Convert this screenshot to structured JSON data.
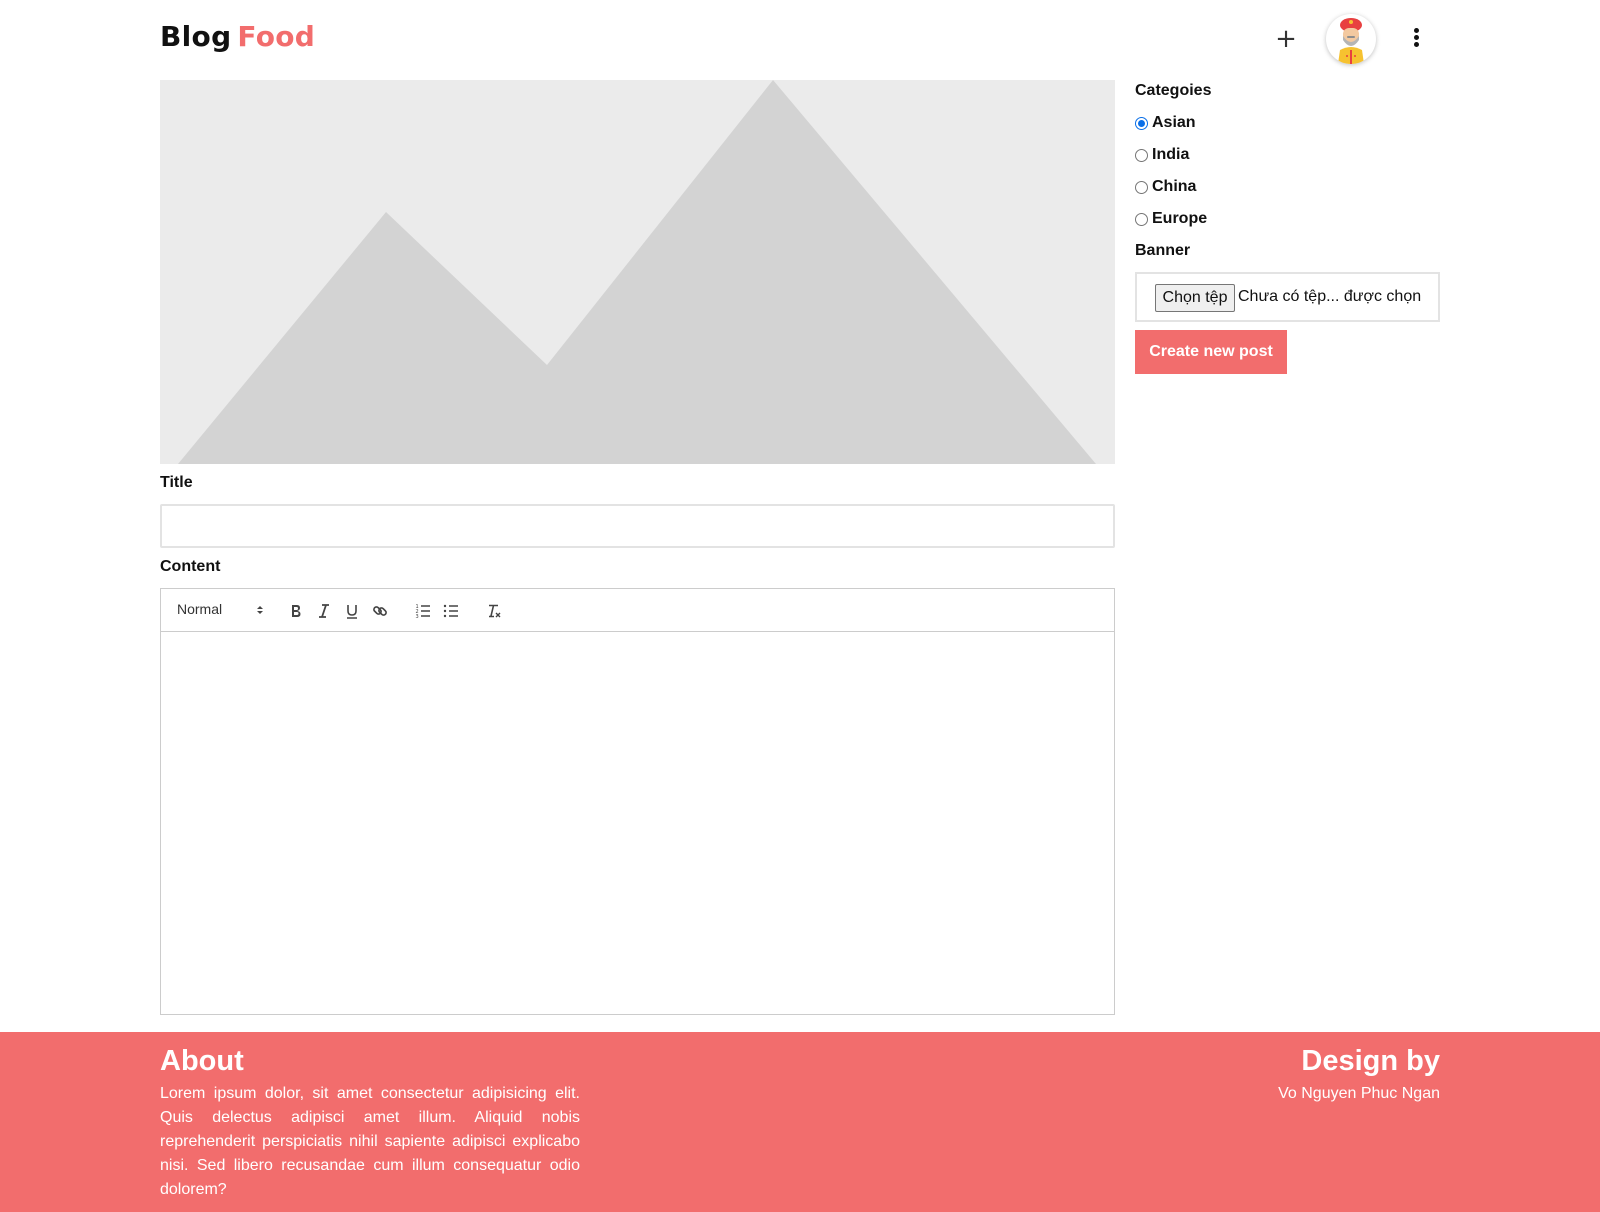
{
  "header": {
    "logo_part1": "Blog",
    "logo_part2": "Food",
    "add_icon": "plus-icon",
    "menu_icon": "more-vertical-icon",
    "brand_color": "#f26d6d"
  },
  "main": {
    "banner_placeholder_icon": "image-placeholder-icon",
    "title_label": "Title",
    "title_value": "",
    "content_label": "Content",
    "toolbar": {
      "format_select": "Normal",
      "bold_icon": "bold-icon",
      "italic_icon": "italic-icon",
      "underline_icon": "underline-icon",
      "link_icon": "link-icon",
      "ordered_list_icon": "ordered-list-icon",
      "bullet_list_icon": "bullet-list-icon",
      "clear_format_icon": "clear-format-icon"
    }
  },
  "sidebar": {
    "categories_label": "Categoies",
    "categories": [
      {
        "label": "Asian",
        "checked": true
      },
      {
        "label": "India",
        "checked": false
      },
      {
        "label": "China",
        "checked": false
      },
      {
        "label": "Europe",
        "checked": false
      }
    ],
    "banner_label": "Banner",
    "file_button": "Chọn tệp",
    "file_status": "Chưa có tệp... được chọn",
    "create_button": "Create new post",
    "radio_accent": "#0a6fe8"
  },
  "footer": {
    "about_title": "About",
    "about_text": "Lorem ipsum dolor, sit amet consectetur adipisicing elit. Quis delectus adipisci amet illum. Aliquid nobis reprehenderit perspiciatis nihil sapiente adipisci explicabo nisi. Sed libero recusandae cum illum consequatur odio dolorem?",
    "design_title": "Design by",
    "design_name": "Vo Nguyen Phuc Ngan"
  }
}
